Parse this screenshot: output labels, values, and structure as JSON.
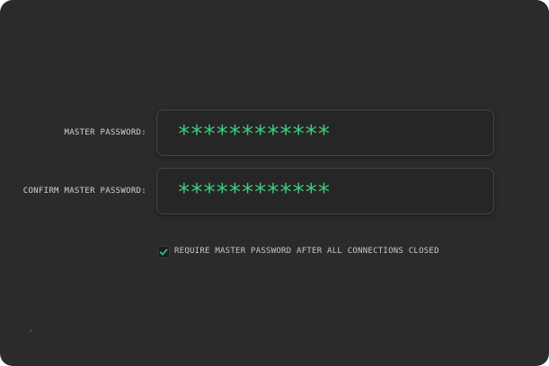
{
  "form": {
    "master_password": {
      "label": "MASTER PASSWORD:",
      "value": "************"
    },
    "confirm_password": {
      "label": "CONFIRM MASTER PASSWORD:",
      "value": "************"
    },
    "require_checkbox": {
      "label": "REQUIRE MASTER PASSWORD AFTER ALL CONNECTIONS CLOSED",
      "checked": true,
      "icon": "check-icon"
    }
  },
  "colors": {
    "background": "#2b2b2b",
    "field_background": "#262626",
    "field_border": "#454545",
    "accent": "#3fca7f",
    "label_text": "#d2d2d2"
  }
}
